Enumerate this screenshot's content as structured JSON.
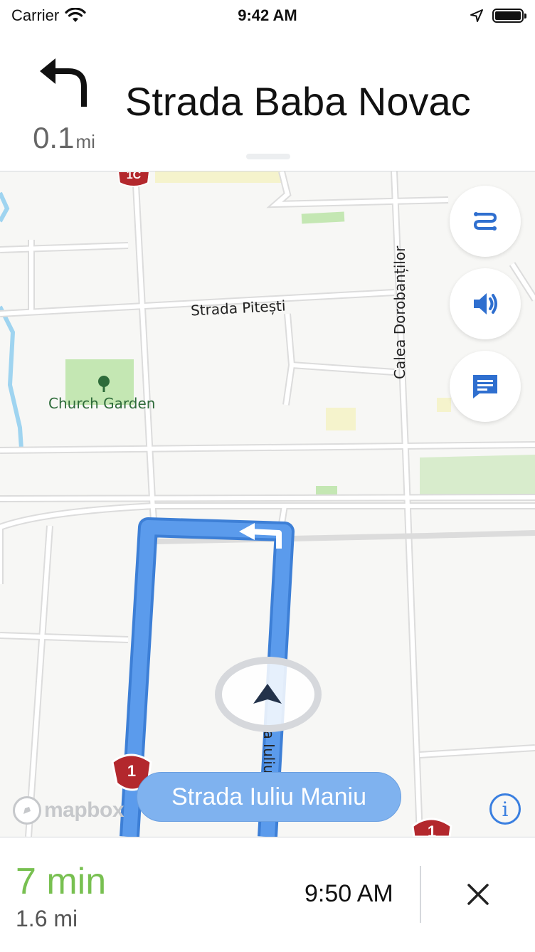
{
  "status_bar": {
    "carrier": "Carrier",
    "time": "9:42 AM"
  },
  "instruction": {
    "distance_value": "0.1",
    "distance_unit": "mi",
    "street": "Strada Baba Novac",
    "maneuver": "turn-left"
  },
  "map": {
    "labels": {
      "strada_pitesti": "Strada Pitești",
      "calea_dorobantilor": "Calea Dorobanților",
      "church_garden": "Church Garden",
      "route_street": "la Iuliu Maniu"
    },
    "shields": [
      "1C",
      "1",
      "1"
    ],
    "current_road": "Strada Iuliu Maniu",
    "attribution": "mapbox",
    "route_color": "#5b9bec",
    "park_color": "#c4e7b3"
  },
  "trip": {
    "remaining_time": "7 min",
    "remaining_distance": "1.6 mi",
    "arrival_time": "9:50 AM"
  },
  "colors": {
    "accent": "#3a7fe0",
    "time_remaining": "#78c051",
    "shield": "#b3282d"
  }
}
